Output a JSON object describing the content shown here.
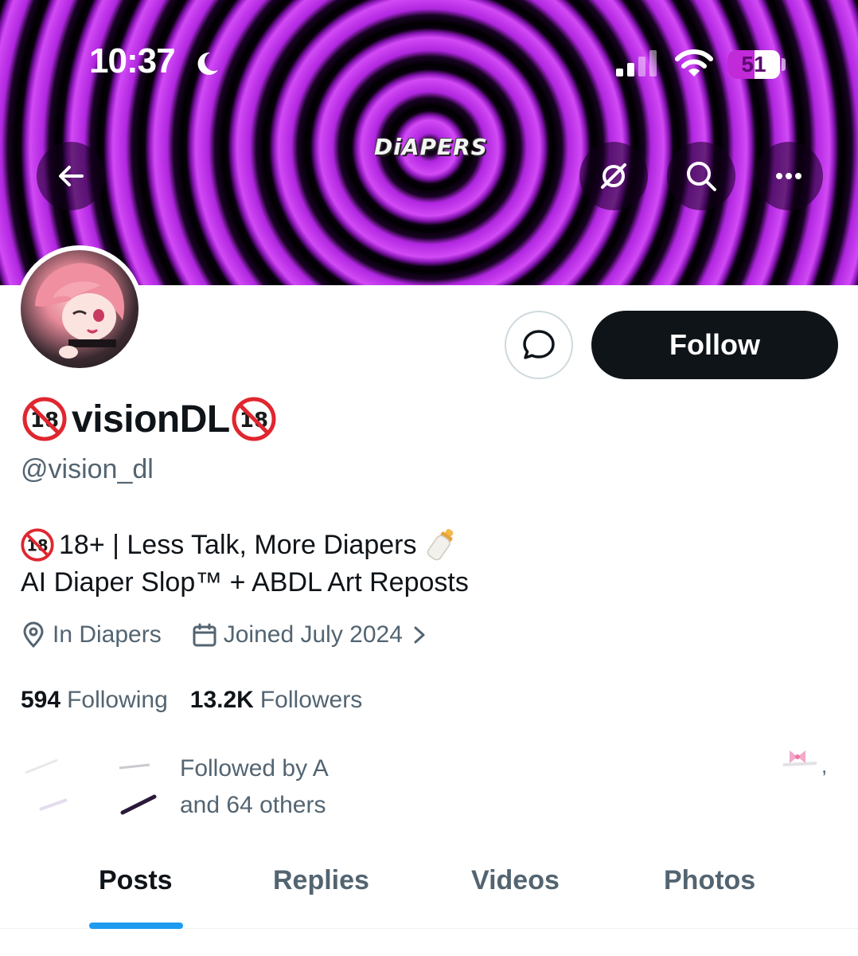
{
  "status_bar": {
    "time": "10:37",
    "battery_level": "51",
    "battery_fraction": 0.51
  },
  "banner": {
    "label": "DiAPERS"
  },
  "header_actions": {
    "back": "arrow-left-icon",
    "grok": "grok-icon",
    "search": "search-icon",
    "more": "more-icon"
  },
  "profile": {
    "display_name": "visionDL",
    "handle": "@vision_dl",
    "bio_line1": "18+ | Less Talk, More Diapers",
    "bio_line2": "AI Diaper Slop™ + ABDL Art Reposts",
    "location": "In Diapers",
    "joined": "Joined July 2024",
    "following_count": "594",
    "following_label": "Following",
    "followers_count": "13.2K",
    "followers_label": "Followers",
    "followed_by_line1": "Followed by A",
    "followed_by_line2": "and 64 others"
  },
  "actions": {
    "follow_label": "Follow"
  },
  "tabs": [
    {
      "label": "Posts",
      "active": true
    },
    {
      "label": "Replies",
      "active": false
    },
    {
      "label": "Videos",
      "active": false
    },
    {
      "label": "Photos",
      "active": false
    }
  ],
  "colors": {
    "accent": "#1d9bf0",
    "banner_purple": "#c12ad8",
    "follow_button": "#0f1419",
    "secondary_text": "#536471"
  }
}
